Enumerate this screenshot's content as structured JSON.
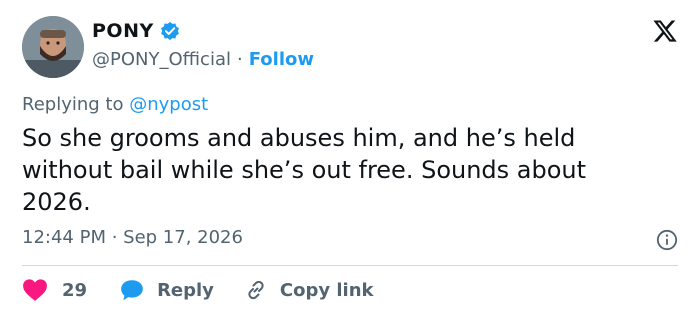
{
  "author": {
    "display_name": "PONY",
    "handle": "@PONY_Official",
    "separator": "·",
    "follow_label": "Follow",
    "verified": true
  },
  "reply": {
    "prefix": "Replying to ",
    "mention": "@nypost"
  },
  "tweet": {
    "text": "So she grooms and abuses him, and he’s held\nwithout bail while she’s out free. Sounds about\n2026."
  },
  "meta": {
    "time": "12:44 PM",
    "separator": " · ",
    "date": "Sep 17, 2026"
  },
  "actions": {
    "like_count": "29",
    "reply_label": "Reply",
    "copy_link_label": "Copy link"
  },
  "icons": {
    "platform_logo": "x-logo-icon",
    "verified": "verified-badge-icon",
    "info": "info-icon",
    "like": "heart-icon",
    "reply": "reply-bubble-icon",
    "copy": "link-icon"
  },
  "colors": {
    "accent": "#1d9bf0",
    "heart": "#f91880",
    "muted_text": "#536471",
    "text": "#0f1419",
    "divider": "#cfd9de"
  }
}
